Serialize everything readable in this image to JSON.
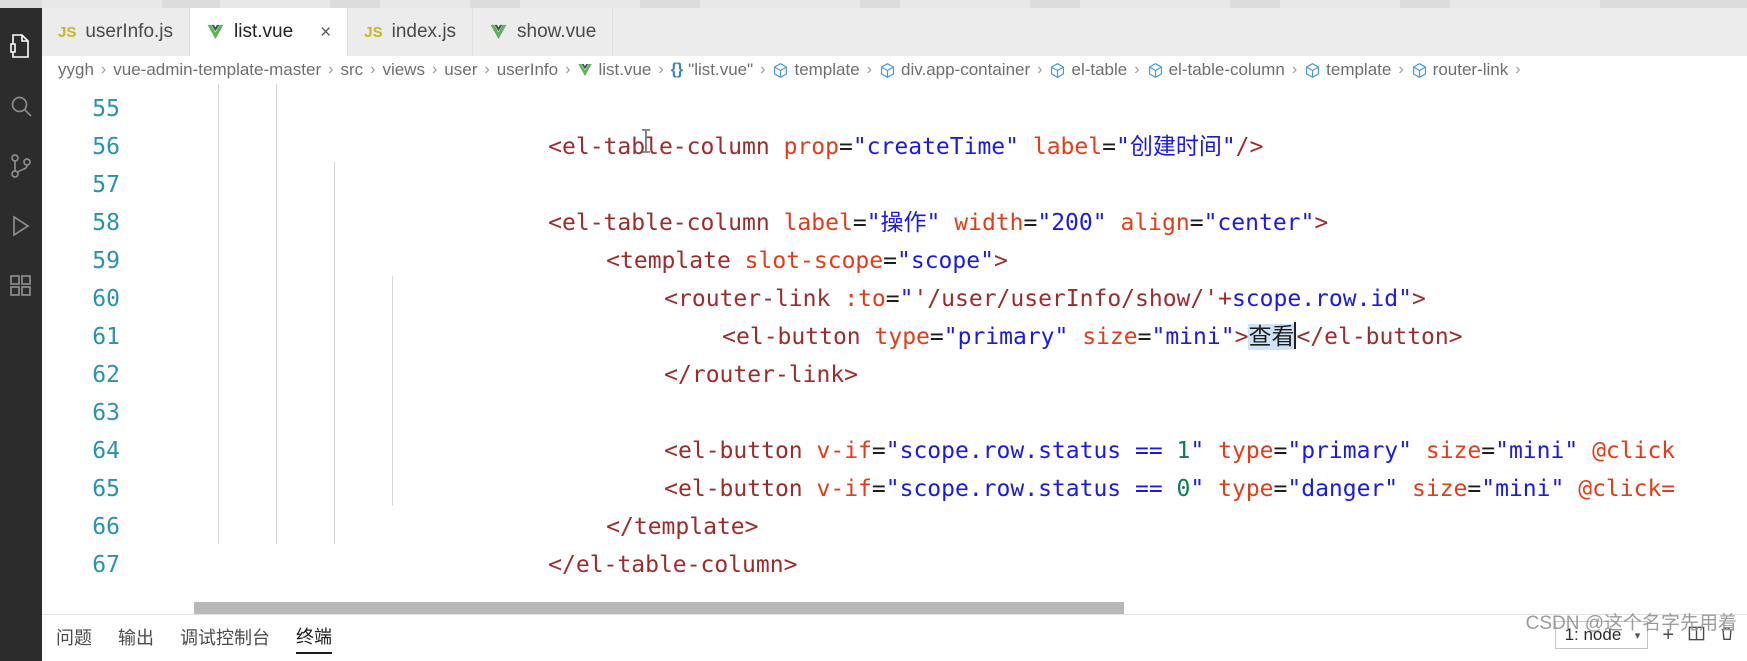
{
  "window": {
    "theme": "light"
  },
  "activitybar": {
    "items": [
      {
        "name": "explorer-icon",
        "glyph": "files",
        "active": true
      },
      {
        "name": "search-icon",
        "glyph": "search",
        "active": false
      },
      {
        "name": "source-control-icon",
        "glyph": "branch",
        "active": false
      },
      {
        "name": "run-debug-icon",
        "glyph": "play",
        "active": false
      },
      {
        "name": "extensions-icon",
        "glyph": "blocks",
        "active": false
      }
    ]
  },
  "tabs": [
    {
      "label": "userInfo.js",
      "icon": "js",
      "icon_text": "JS",
      "active": false,
      "closable": false
    },
    {
      "label": "list.vue",
      "icon": "vue",
      "icon_text": "V",
      "active": true,
      "closable": true,
      "close_label": "×"
    },
    {
      "label": "index.js",
      "icon": "js",
      "icon_text": "JS",
      "active": false,
      "closable": false
    },
    {
      "label": "show.vue",
      "icon": "vue",
      "icon_text": "V",
      "active": false,
      "closable": false
    }
  ],
  "breadcrumbs": [
    {
      "label": "yygh",
      "icon": "none"
    },
    {
      "label": "vue-admin-template-master",
      "icon": "none"
    },
    {
      "label": "src",
      "icon": "none"
    },
    {
      "label": "views",
      "icon": "none"
    },
    {
      "label": "user",
      "icon": "none"
    },
    {
      "label": "userInfo",
      "icon": "none"
    },
    {
      "label": "list.vue",
      "icon": "vue"
    },
    {
      "label": "\"list.vue\"",
      "icon": "braces"
    },
    {
      "label": "template",
      "icon": "cube"
    },
    {
      "label": "div.app-container",
      "icon": "cube"
    },
    {
      "label": "el-table",
      "icon": "cube"
    },
    {
      "label": "el-table-column",
      "icon": "cube"
    },
    {
      "label": "template",
      "icon": "cube"
    },
    {
      "label": "router-link",
      "icon": "cube"
    }
  ],
  "breadcrumb_separator": "›",
  "editor": {
    "first_line_number": 55,
    "line_numbers": [
      "55",
      "56",
      "57",
      "58",
      "59",
      "60",
      "61",
      "62",
      "63",
      "64",
      "65",
      "66",
      "67"
    ],
    "lines": [
      {
        "n": "55",
        "indent": 4,
        "text": "<el-table-column prop=\"createTime\" label=\"创建时间\"/>"
      },
      {
        "n": "56",
        "indent": 0,
        "text": ""
      },
      {
        "n": "57",
        "indent": 4,
        "text": "<el-table-column label=\"操作\" width=\"200\" align=\"center\">"
      },
      {
        "n": "58",
        "indent": 6,
        "text": "<template slot-scope=\"scope\">"
      },
      {
        "n": "59",
        "indent": 8,
        "text": "<router-link :to=\"'/user/userInfo/show/'+scope.row.id\">"
      },
      {
        "n": "60",
        "indent": 10,
        "text": "<el-button type=\"primary\" size=\"mini\">查看</el-button>"
      },
      {
        "n": "61",
        "indent": 8,
        "text": "</router-link>"
      },
      {
        "n": "62",
        "indent": 0,
        "text": ""
      },
      {
        "n": "63",
        "indent": 8,
        "text": "<el-button v-if=\"scope.row.status == 1\" type=\"primary\" size=\"mini\" @click"
      },
      {
        "n": "64",
        "indent": 8,
        "text": "<el-button v-if=\"scope.row.status == 0\" type=\"danger\" size=\"mini\" @click="
      },
      {
        "n": "65",
        "indent": 6,
        "text": "</template>"
      },
      {
        "n": "66",
        "indent": 4,
        "text": "</el-table-column>"
      },
      {
        "n": "67",
        "indent": 0,
        "text": ""
      }
    ],
    "selection_text": "查看",
    "selection_line": "60",
    "tokens": {
      "l55": [
        {
          "t": "<el-table-column ",
          "c": "tag"
        },
        {
          "t": "prop",
          "c": "attr"
        },
        {
          "t": "=",
          "c": "punc"
        },
        {
          "t": "\"createTime\"",
          "c": "val"
        },
        {
          "t": " ",
          "c": "punc"
        },
        {
          "t": "label",
          "c": "attr"
        },
        {
          "t": "=",
          "c": "punc"
        },
        {
          "t": "\"创建时间\"",
          "c": "val"
        },
        {
          "t": "/>",
          "c": "tag"
        }
      ],
      "l57": [
        {
          "t": "<el-table-column ",
          "c": "tag"
        },
        {
          "t": "label",
          "c": "attr"
        },
        {
          "t": "=",
          "c": "punc"
        },
        {
          "t": "\"操作\"",
          "c": "val"
        },
        {
          "t": " ",
          "c": "punc"
        },
        {
          "t": "width",
          "c": "attr"
        },
        {
          "t": "=",
          "c": "punc"
        },
        {
          "t": "\"200\"",
          "c": "val"
        },
        {
          "t": " ",
          "c": "punc"
        },
        {
          "t": "align",
          "c": "attr"
        },
        {
          "t": "=",
          "c": "punc"
        },
        {
          "t": "\"center\"",
          "c": "val"
        },
        {
          "t": ">",
          "c": "tag"
        }
      ],
      "l58": [
        {
          "t": "<template ",
          "c": "tag"
        },
        {
          "t": "slot-scope",
          "c": "attr"
        },
        {
          "t": "=",
          "c": "punc"
        },
        {
          "t": "\"scope\"",
          "c": "val"
        },
        {
          "t": ">",
          "c": "tag"
        }
      ],
      "l59": [
        {
          "t": "<router-link ",
          "c": "tag"
        },
        {
          "t": ":to",
          "c": "attr"
        },
        {
          "t": "=",
          "c": "punc"
        },
        {
          "t": "\"",
          "c": "val"
        },
        {
          "t": "'/user/userInfo/show/'",
          "c": "tag"
        },
        {
          "t": "+",
          "c": "tag"
        },
        {
          "t": "scope.row.id",
          "c": "val"
        },
        {
          "t": "\"",
          "c": "val"
        },
        {
          "t": ">",
          "c": "tag"
        }
      ],
      "l60": [
        {
          "t": "<el-button ",
          "c": "tag"
        },
        {
          "t": "type",
          "c": "attr"
        },
        {
          "t": "=",
          "c": "punc"
        },
        {
          "t": "\"primary\"",
          "c": "val"
        },
        {
          "t": " ",
          "c": "punc"
        },
        {
          "t": "size",
          "c": "attr"
        },
        {
          "t": "=",
          "c": "punc"
        },
        {
          "t": "\"mini\"",
          "c": "val"
        },
        {
          "t": ">",
          "c": "tag"
        },
        {
          "t": "查看",
          "c": "sel"
        },
        {
          "t": "</el-button>",
          "c": "tag"
        }
      ],
      "l61": [
        {
          "t": "</router-link>",
          "c": "tag"
        }
      ],
      "l63": [
        {
          "t": "<el-button ",
          "c": "tag"
        },
        {
          "t": "v-if",
          "c": "attr"
        },
        {
          "t": "=",
          "c": "punc"
        },
        {
          "t": "\"scope.row.status == ",
          "c": "val"
        },
        {
          "t": "1",
          "c": "num"
        },
        {
          "t": "\"",
          "c": "val"
        },
        {
          "t": " ",
          "c": "punc"
        },
        {
          "t": "type",
          "c": "attr"
        },
        {
          "t": "=",
          "c": "punc"
        },
        {
          "t": "\"primary\"",
          "c": "val"
        },
        {
          "t": " ",
          "c": "punc"
        },
        {
          "t": "size",
          "c": "attr"
        },
        {
          "t": "=",
          "c": "punc"
        },
        {
          "t": "\"mini\"",
          "c": "val"
        },
        {
          "t": " ",
          "c": "punc"
        },
        {
          "t": "@click",
          "c": "attr"
        }
      ],
      "l64": [
        {
          "t": "<el-button ",
          "c": "tag"
        },
        {
          "t": "v-if",
          "c": "attr"
        },
        {
          "t": "=",
          "c": "punc"
        },
        {
          "t": "\"scope.row.status == ",
          "c": "val"
        },
        {
          "t": "0",
          "c": "num"
        },
        {
          "t": "\"",
          "c": "val"
        },
        {
          "t": " ",
          "c": "punc"
        },
        {
          "t": "type",
          "c": "attr"
        },
        {
          "t": "=",
          "c": "punc"
        },
        {
          "t": "\"danger\"",
          "c": "val"
        },
        {
          "t": " ",
          "c": "punc"
        },
        {
          "t": "size",
          "c": "attr"
        },
        {
          "t": "=",
          "c": "punc"
        },
        {
          "t": "\"mini\"",
          "c": "val"
        },
        {
          "t": " ",
          "c": "punc"
        },
        {
          "t": "@click=",
          "c": "attr"
        }
      ],
      "l65": [
        {
          "t": "</template>",
          "c": "tag"
        }
      ],
      "l66": [
        {
          "t": "</el-table-column>",
          "c": "tag"
        }
      ]
    }
  },
  "panel": {
    "tabs": [
      {
        "label": "问题",
        "active": false
      },
      {
        "label": "输出",
        "active": false
      },
      {
        "label": "调试控制台",
        "active": false
      },
      {
        "label": "终端",
        "active": true
      }
    ],
    "terminal_select": "1: node",
    "chevron": "▾",
    "add_icon": "+",
    "split_icon": "⬚",
    "trash_icon": "🗑",
    "filter_icon": "⌥"
  },
  "watermark": "CSDN @这个名字先用着",
  "colors": {
    "accent_blue": "#2b91af",
    "tag_red": "#9b2c2c",
    "attr_orange": "#e03e1a",
    "value_blue": "#1a1ae0",
    "number_green": "#0f7b52",
    "selection": "#cfe3f7",
    "activitybar_bg": "#2c2c2c",
    "tabbar_bg": "#ececec"
  }
}
